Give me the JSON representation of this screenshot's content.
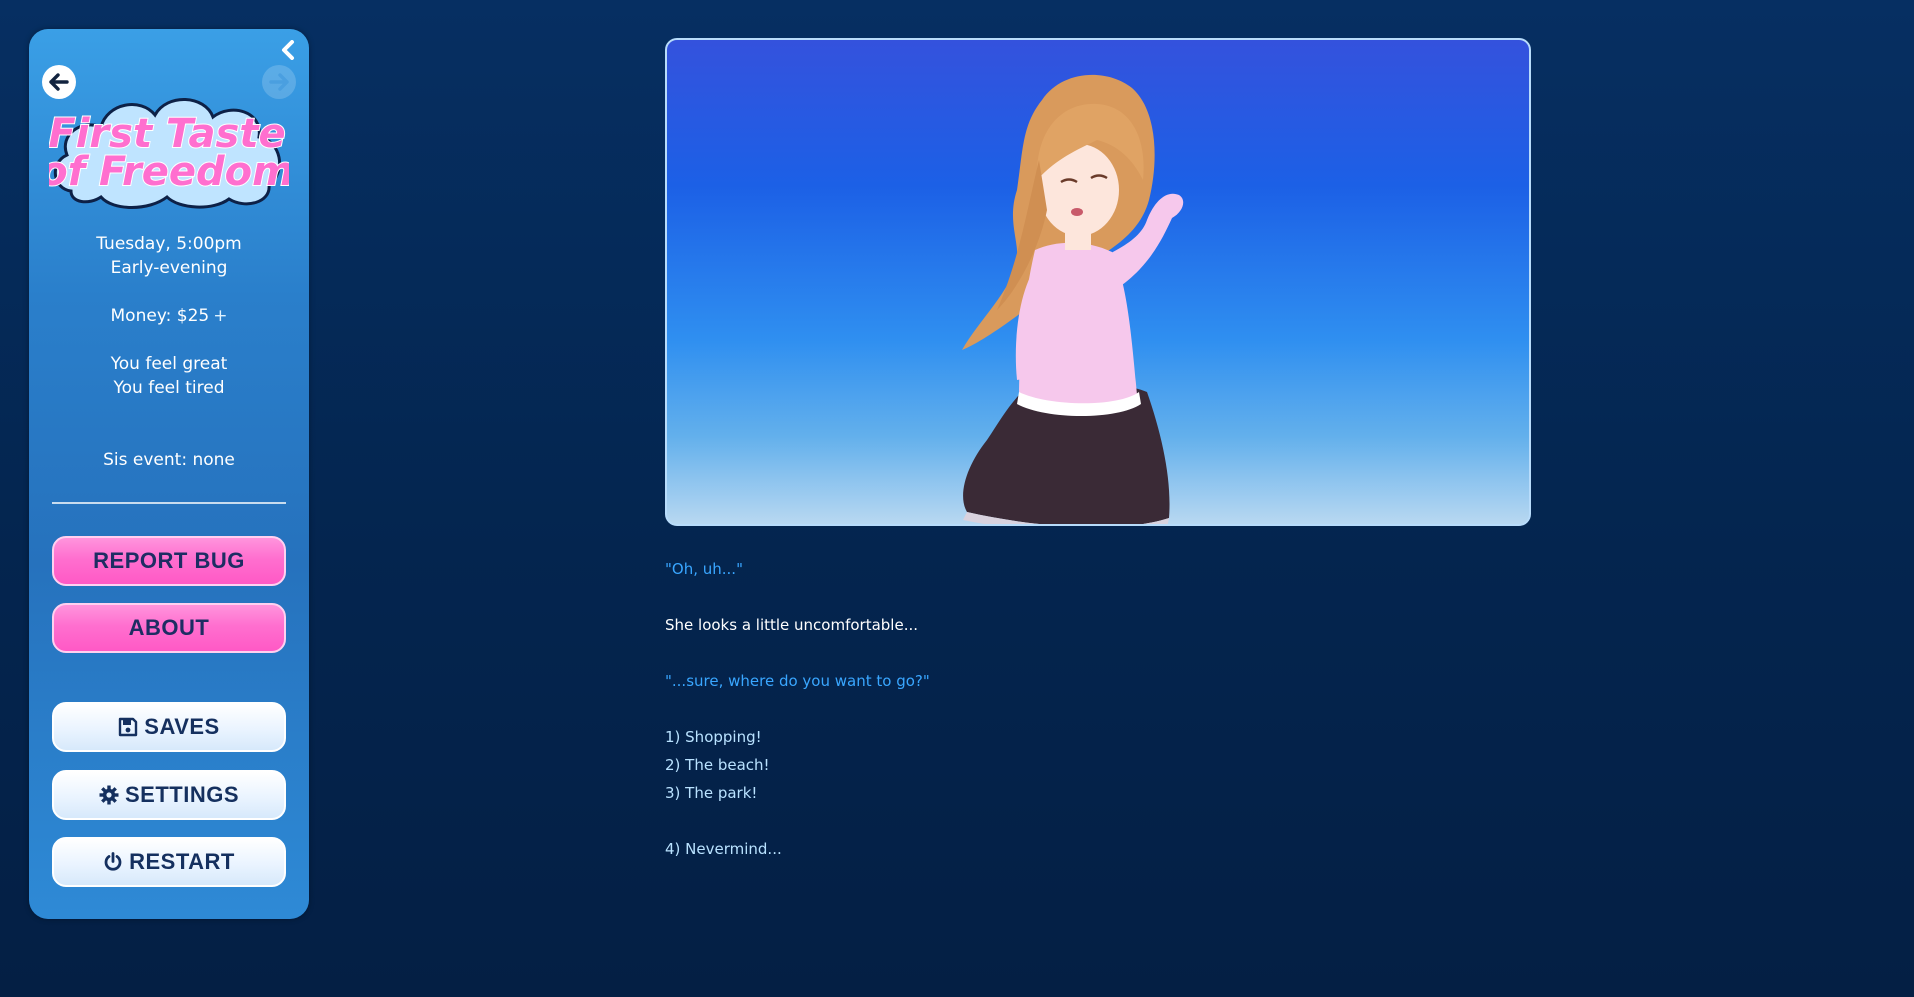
{
  "sidebar": {
    "game_title_line1": "First Taste",
    "game_title_line2": "of Freedom",
    "day_time": "Tuesday, 5:00pm",
    "period": "Early-evening",
    "money": "Money: $25",
    "money_plus": "+",
    "mood": "You feel great",
    "energy": "You feel tired",
    "sis_event": "Sis event: none",
    "buttons": {
      "report_bug": "REPORT BUG",
      "about": "ABOUT",
      "saves": "SAVES",
      "settings": "SETTINGS",
      "restart": "RESTART"
    },
    "icons": {
      "back": "arrow-left-icon",
      "forward": "arrow-right-icon",
      "collapse": "chevron-left-icon",
      "saves": "floppy-disk-icon",
      "settings": "gear-icon",
      "restart": "power-icon"
    }
  },
  "passage": {
    "line1": "\"Oh, uh...\"",
    "line2": "She looks a little uncomfortable...",
    "line3": "\"...sure, where do you want to go?\"",
    "choices": [
      "1) Shopping!",
      "2) The beach!",
      "3) The park!",
      "4) Nevermind..."
    ]
  },
  "colors": {
    "background": "#04254f",
    "sidebar": "#2a7fcb",
    "pink_button": "#ff6fcf",
    "speech_text": "#39a6ff",
    "choice_text": "#b9e2ff"
  }
}
